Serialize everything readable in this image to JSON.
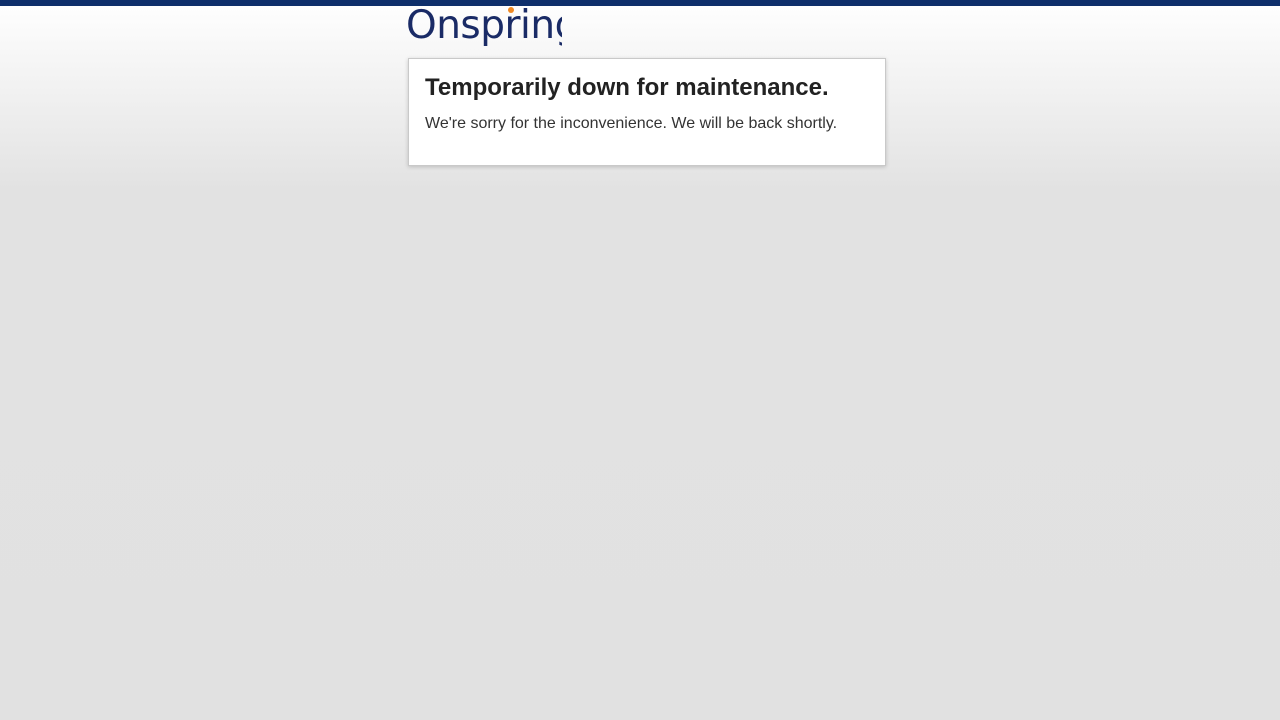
{
  "brand": {
    "name": "Onspring",
    "primary_color": "#1a2b66",
    "accent_color": "#f08a24",
    "top_bar_color": "#0e2f6b"
  },
  "maintenance": {
    "title": "Temporarily down for maintenance.",
    "message": "We're sorry for the inconvenience. We will be back shortly."
  }
}
